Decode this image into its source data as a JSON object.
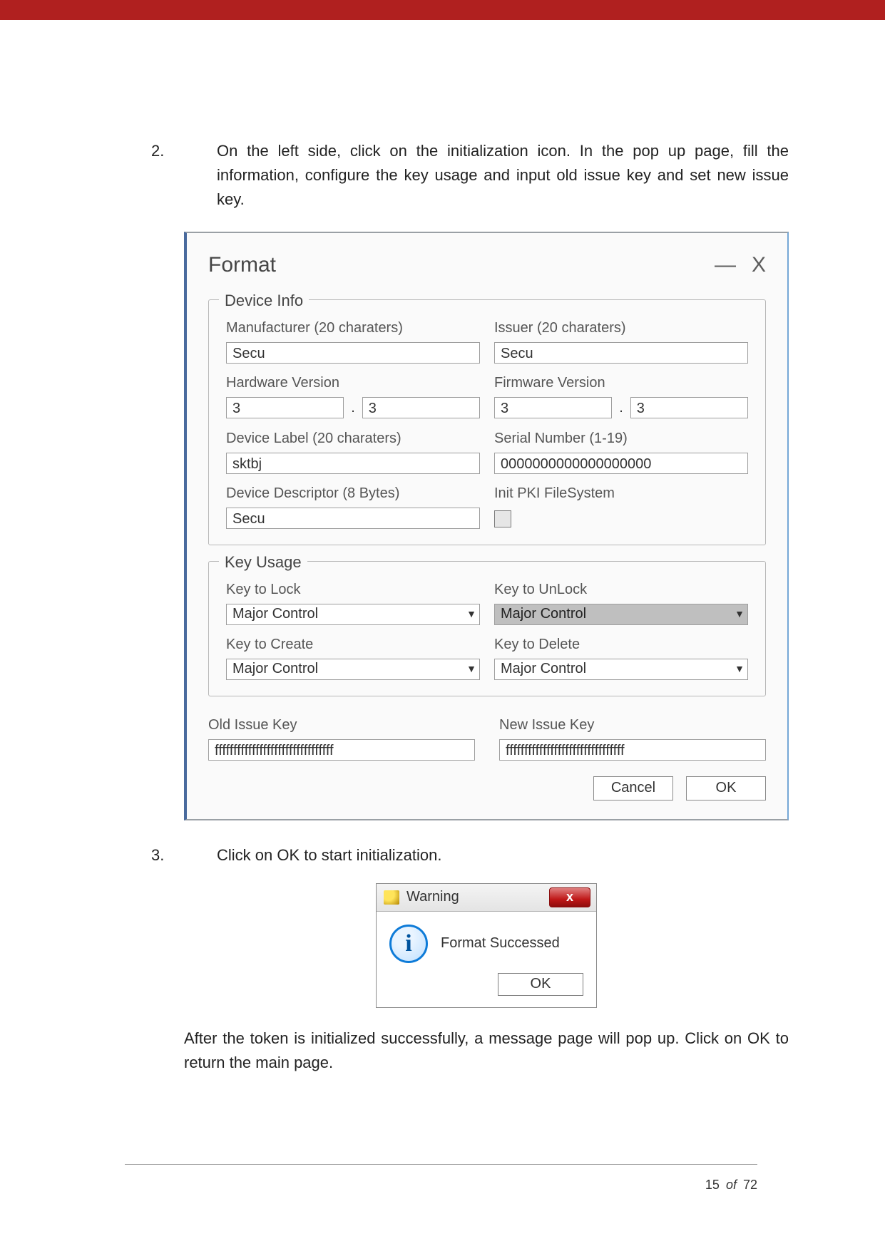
{
  "step2": {
    "num": "2.",
    "text": "On the left side, click on the initialization icon. In the pop up page, fill the information, configure the key usage and input old issue key and set new issue key."
  },
  "format_dialog": {
    "title": "Format",
    "minimize": "—",
    "close": "X",
    "device_info": {
      "legend": "Device Info",
      "manufacturer": {
        "label": "Manufacturer (20 charaters)",
        "value": "Secu"
      },
      "issuer": {
        "label": "Issuer (20 charaters)",
        "value": "Secu"
      },
      "hw": {
        "label": "Hardware Version",
        "major": "3",
        "minor": "3"
      },
      "fw": {
        "label": "Firmware Version",
        "major": "3",
        "minor": "3"
      },
      "device_label": {
        "label": "Device Label (20 charaters)",
        "value": "sktbj"
      },
      "serial": {
        "label": "Serial Number (1-19)",
        "value": "0000000000000000000"
      },
      "descriptor": {
        "label": "Device Descriptor (8 Bytes)",
        "value": "Secu"
      },
      "init_pki": {
        "label": "Init PKI FileSystem"
      }
    },
    "key_usage": {
      "legend": "Key Usage",
      "lock": {
        "label": "Key to Lock",
        "value": "Major Control"
      },
      "unlock": {
        "label": "Key to UnLock",
        "value": "Major Control"
      },
      "create": {
        "label": "Key to Create",
        "value": "Major Control"
      },
      "delete": {
        "label": "Key to Delete",
        "value": "Major Control"
      }
    },
    "old_key": {
      "label": "Old Issue Key",
      "value": "ffffffffffffffffffffffffffffffff"
    },
    "new_key": {
      "label": "New Issue Key",
      "value": "ffffffffffffffffffffffffffffffff"
    },
    "buttons": {
      "cancel": "Cancel",
      "ok": "OK"
    }
  },
  "step3": {
    "num": "3.",
    "text": "Click on OK to start initialization."
  },
  "warning": {
    "title": "Warning",
    "close_x": "x",
    "message": "Format Successed",
    "ok": "OK"
  },
  "after_text": "After the token is initialized successfully, a message page will pop up. Click on OK to return the main page.",
  "footer": {
    "page": "15",
    "of": "of",
    "total": "72"
  }
}
